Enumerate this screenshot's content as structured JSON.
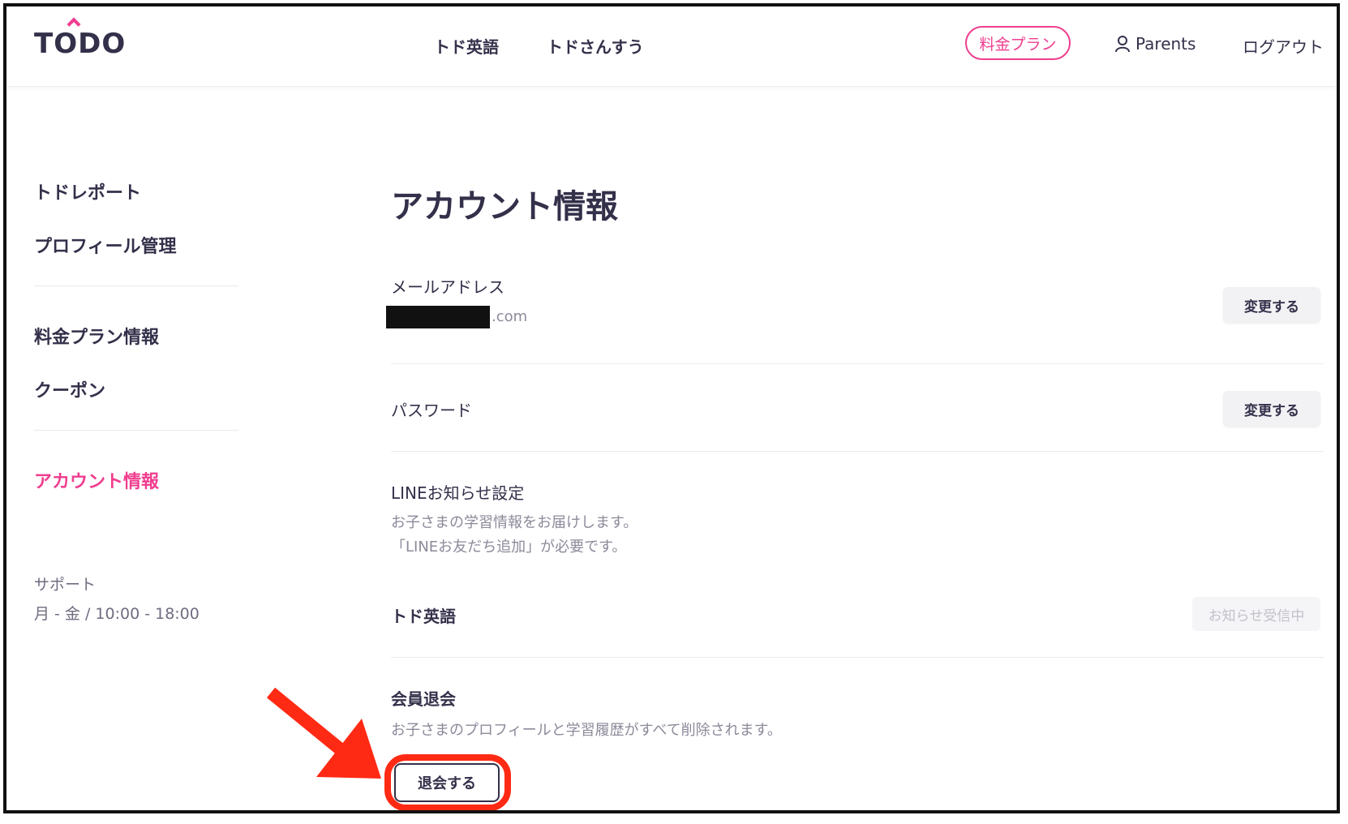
{
  "header": {
    "logo": "TODO",
    "nav": [
      "トド英語",
      "トドさんすう"
    ],
    "plan_button": "料金プラン",
    "user_label": "Parents",
    "logout": "ログアウト"
  },
  "sidebar": {
    "items": [
      {
        "label": "トドレポート"
      },
      {
        "label": "プロフィール管理"
      },
      {
        "label": "料金プラン情報"
      },
      {
        "label": "クーポン"
      },
      {
        "label": "アカウント情報",
        "active": true
      }
    ],
    "support_title": "サポート",
    "support_hours": "月 - 金 / 10:00 - 18:00"
  },
  "main": {
    "title": "アカウント情報",
    "email": {
      "label": "メールアドレス",
      "value_suffix": ".com",
      "button": "変更する"
    },
    "password": {
      "label": "パスワード",
      "button": "変更する"
    },
    "line": {
      "label": "LINEお知らせ設定",
      "desc_line1": "お子さまの学習情報をお届けします。",
      "desc_line2": "「LINEお友だち追加」が必要です。",
      "service_label": "トド英語",
      "status_button": "お知らせ受信中"
    },
    "withdraw": {
      "label": "会員退会",
      "desc": "お子さまのプロフィールと学習履歴がすべて削除されます。",
      "button": "退会する"
    }
  },
  "colors": {
    "accent": "#ef3e8f",
    "text": "#33304a",
    "muted": "#8c8a9a",
    "annotation": "#ff2a14"
  }
}
